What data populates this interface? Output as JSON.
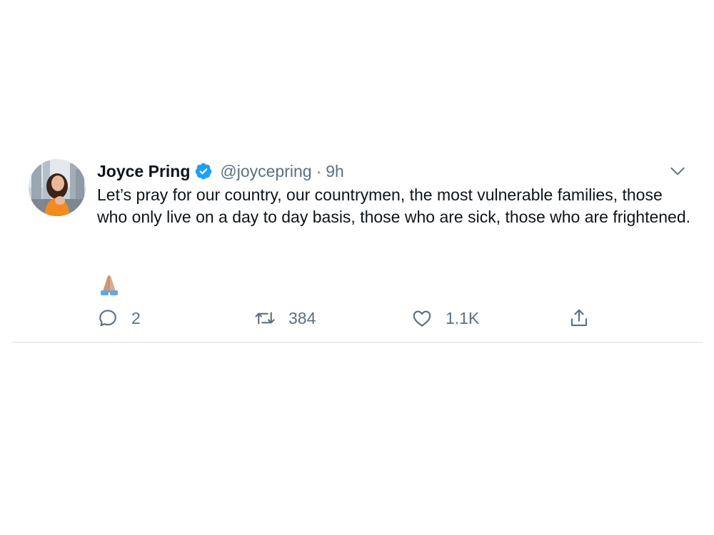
{
  "tweet": {
    "display_name": "Joyce Pring",
    "handle": "@joycepring",
    "separator": "·",
    "time": "9h",
    "text": "Let’s pray for our country, our countrymen, the most vulnerable families, those who only live on a day to day basis, those who are sick, those who are frightened.",
    "emoji": "folded-hands-emoji",
    "counts": {
      "replies": "2",
      "retweets": "384",
      "likes": "1.1K"
    }
  },
  "icons": {
    "verified": "verified-badge-icon",
    "caret": "chevron-down-icon",
    "reply": "reply-icon",
    "retweet": "retweet-icon",
    "like": "heart-icon",
    "share": "share-icon"
  },
  "colors": {
    "verified_blue": "#1da1f2",
    "secondary_text": "#5b7083",
    "divider": "#e6ecf0"
  }
}
